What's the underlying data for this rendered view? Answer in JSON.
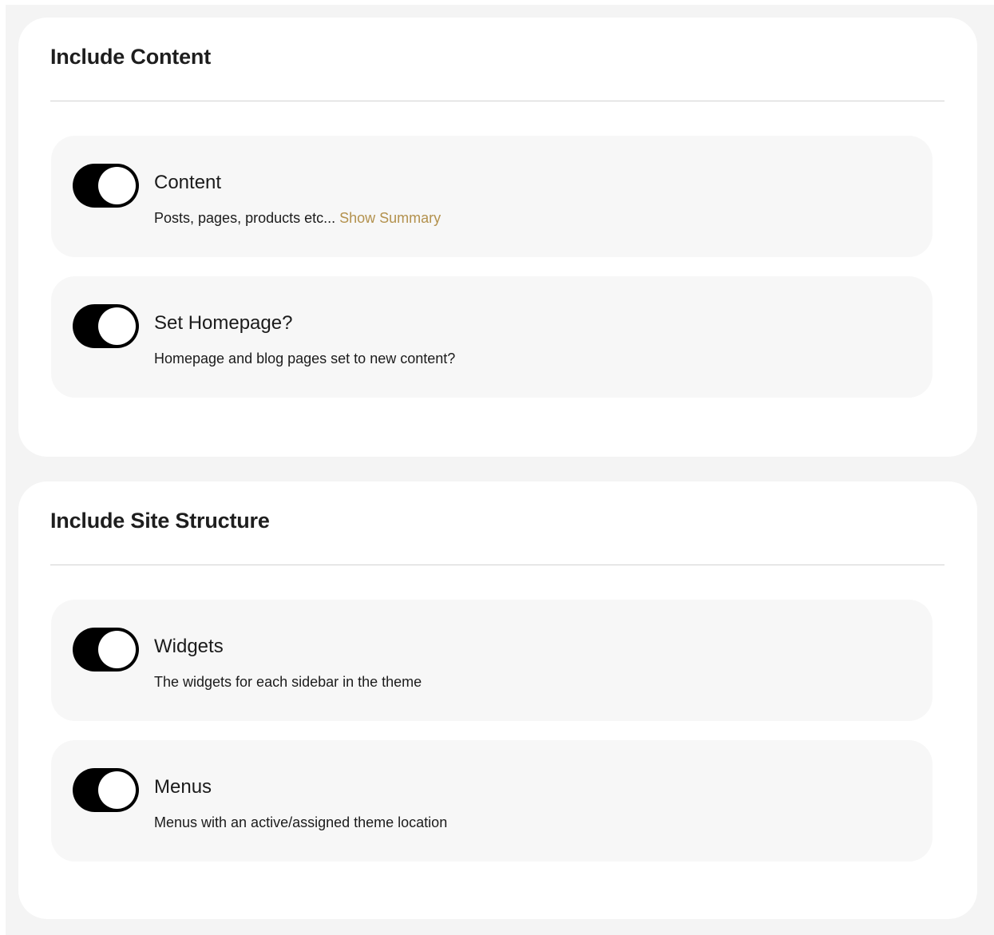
{
  "sections": [
    {
      "title": "Include Content",
      "options": [
        {
          "title": "Content",
          "description": "Posts, pages, products etc...",
          "link": "Show Summary",
          "enabled": true
        },
        {
          "title": "Set Homepage?",
          "description": "Homepage and blog pages set to new content?",
          "enabled": true
        }
      ]
    },
    {
      "title": "Include Site Structure",
      "options": [
        {
          "title": "Widgets",
          "description": "The widgets for each sidebar in the theme",
          "enabled": true
        },
        {
          "title": "Menus",
          "description": "Menus with an active/assigned theme location",
          "enabled": true
        }
      ]
    }
  ],
  "colors": {
    "toggle_on": "#000000",
    "link": "#b3914d",
    "card_bg": "#ffffff",
    "row_bg": "#f7f7f7",
    "page_bg": "#f4f4f4"
  }
}
